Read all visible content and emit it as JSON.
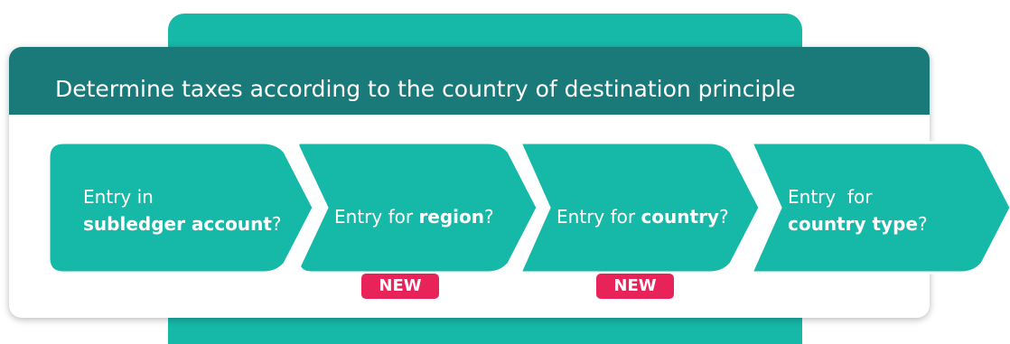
{
  "title": "Determine taxes according to the country of destination principle",
  "steps": [
    {
      "line1": "Entry in",
      "prefix": "",
      "bold": "subledger account",
      "suffix": "?"
    },
    {
      "line1": "",
      "prefix": "Entry for ",
      "bold": "region",
      "suffix": "?"
    },
    {
      "line1": "",
      "prefix": "Entry for ",
      "bold": "country",
      "suffix": "?"
    },
    {
      "line1": "Entry  for",
      "prefix": "",
      "bold": "country type",
      "suffix": "?"
    }
  ],
  "badges": [
    "NEW",
    "NEW"
  ],
  "colors": {
    "header": "#1a7a7a",
    "step_fill": "#16b8a8",
    "back_panel": "#16b8a8",
    "badge": "#e8235a",
    "text": "#ffffff"
  }
}
